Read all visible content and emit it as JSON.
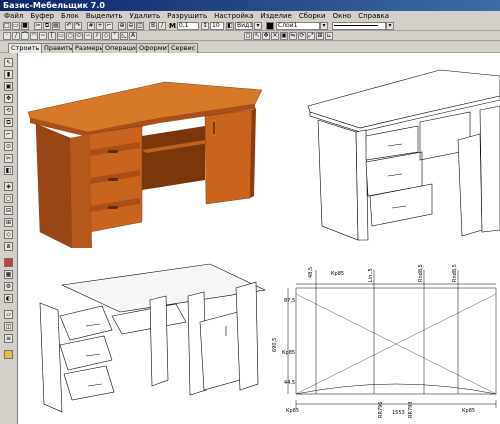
{
  "app": {
    "title": "Базис-Мебельщик 7.0"
  },
  "menu": [
    "Файл",
    "Буфер",
    "Блок",
    "Выделить",
    "Удалить",
    "Разрушить",
    "Настройка",
    "Изделие",
    "Сборки",
    "Окно",
    "Справка"
  ],
  "toolbar": {
    "thickness_label": "М",
    "thickness_value": "0,1",
    "size_value": "10",
    "view_value": "Вид1",
    "layer_value": "Слой1"
  },
  "tabs": [
    "Строить",
    "Править",
    "Размеры",
    "Операции",
    "Оформить",
    "Сервис"
  ],
  "dimensions": {
    "d1": "48,5",
    "d2": "Lin..5",
    "d3": "Rnd8,5",
    "d4": "Rnd8,5",
    "d5": "87,5",
    "d6": "Кр85",
    "d7": "Кр85",
    "d8": "Кр85",
    "d9": "Кр85",
    "d10": "690,5",
    "d11": "44,5",
    "d12": "RR796",
    "d13": "1553",
    "d14": "RR793"
  },
  "colors": {
    "wood": "#c8641e",
    "wood_dark": "#8c3c0a",
    "toolbar_bg": "#d4d0c8",
    "title_bg": "#0a246a"
  }
}
